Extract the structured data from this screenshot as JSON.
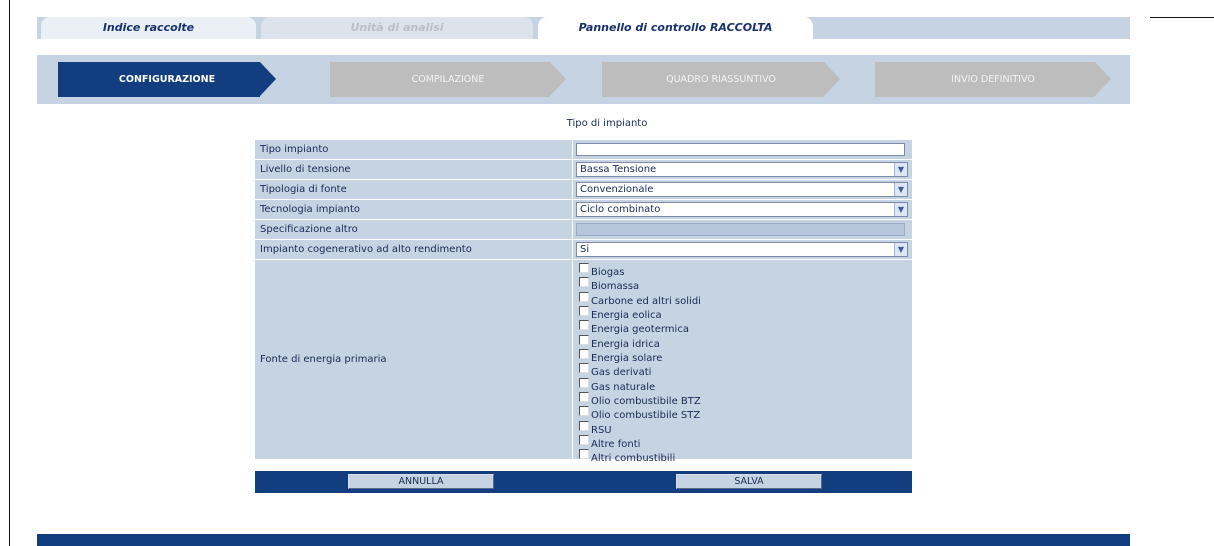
{
  "tabs": [
    {
      "label": "Indice raccolte",
      "state": "inactive"
    },
    {
      "label": "Unità di analisi",
      "state": "disabled"
    },
    {
      "label": "Pannello di controllo RACCOLTA",
      "state": "active"
    }
  ],
  "steps": [
    {
      "label": "CONFIGURAZIONE",
      "state": "active"
    },
    {
      "label": "COMPILAZIONE",
      "state": "inactive"
    },
    {
      "label": "QUADRO RIASSUNTIVO",
      "state": "inactive"
    },
    {
      "label": "INVIO DEFINITIVO",
      "state": "inactive"
    }
  ],
  "section_title": "Tipo di impianto",
  "form": {
    "tipo_impianto": {
      "label": "Tipo impianto",
      "value": ""
    },
    "livello_tensione": {
      "label": "Livello di tensione",
      "value": "Bassa Tensione"
    },
    "tipologia_fonte": {
      "label": "Tipologia di fonte",
      "value": "Convenzionale"
    },
    "tecnologia": {
      "label": "Tecnologia impianto",
      "value": "Ciclo combinato"
    },
    "specificazione": {
      "label": "Specificazione altro",
      "value": ""
    },
    "cogenerativo": {
      "label": "Impianto cogenerativo ad alto rendimento",
      "value": "Si"
    },
    "fonte_primaria": {
      "label": "Fonte di energia primaria",
      "options": [
        "Biogas",
        "Biomassa",
        "Carbone ed altri solidi",
        "Energia eolica",
        "Energia geotermica",
        "Energia idrica",
        "Energia solare",
        "Gas derivati",
        "Gas naturale",
        "Olio combustibile BTZ",
        "Olio combustibile STZ",
        "RSU",
        "Altre fonti",
        "Altri combustibili"
      ]
    }
  },
  "buttons": {
    "annulla": "ANNULLA",
    "salva": "SALVA"
  },
  "icons": {
    "dropdown": "chevron-down-icon",
    "checkbox": "checkbox-unchecked"
  },
  "colors": {
    "primary": "#123e80",
    "panel": "#c5d3e2",
    "inactive_step": "#bdbdbd"
  }
}
